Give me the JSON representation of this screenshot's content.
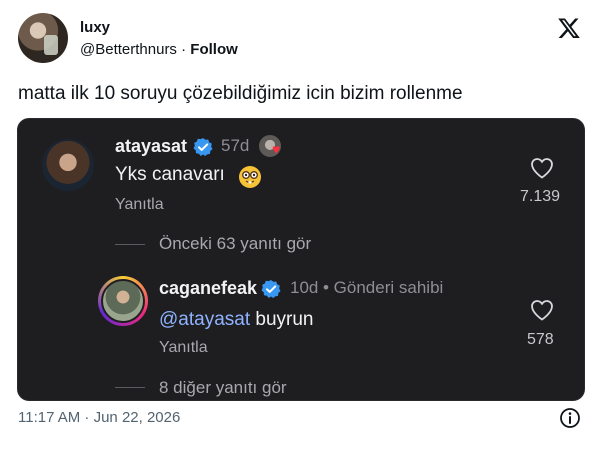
{
  "author": {
    "display_name": "luxy",
    "handle": "@Betterthnurs",
    "separator": "·",
    "follow_label": "Follow",
    "avatar_icon": "profile-photo",
    "brand_icon": "x-logo-icon"
  },
  "tweet": {
    "text": "matta ilk 10 soruyu çözebildiğimiz icin bizim rollenme",
    "timestamp": "11:17 AM · Jun 22, 2026"
  },
  "embedded_comments": {
    "comment1": {
      "username": "atayasat",
      "age": "57d",
      "text": "Yks canavarı",
      "emoji": "nerd-face",
      "reply_label": "Yanıtla",
      "like_count": "7.139",
      "view_replies": "Önceki 63 yanıtı gör"
    },
    "comment2": {
      "username": "caganefeak",
      "age": "10d",
      "owner_label": "• Gönderi sahibi",
      "mention": "@atayasat",
      "text": " buyrun",
      "reply_label": "Yanıtla",
      "like_count": "578",
      "view_more": "8 diğer yanıtı gör"
    },
    "colors": {
      "background": "#1e1e21",
      "mention": "#8fb3ff",
      "verified": "#3897f0",
      "heart_liked": "#ff3040"
    }
  }
}
